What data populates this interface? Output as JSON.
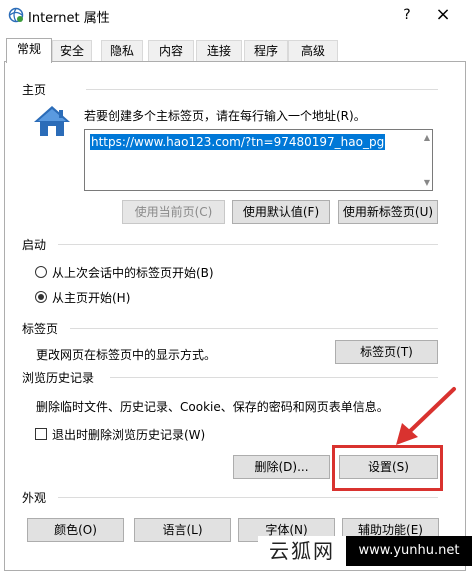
{
  "window": {
    "title": "Internet 属性",
    "help": "?",
    "close": "×"
  },
  "tabs": [
    "常规",
    "安全",
    "隐私",
    "内容",
    "连接",
    "程序",
    "高级"
  ],
  "home": {
    "group_label": "主页",
    "instruction": "若要创建多个主标签页，请在每行输入一个地址(R)。",
    "url": "https://www.hao123.com/?tn=97480197_hao_pg",
    "buttons": {
      "use_current": "使用当前页(C)",
      "use_default": "使用默认值(F)",
      "use_new_tab": "使用新标签页(U)"
    }
  },
  "startup": {
    "group_label": "启动",
    "option_last_session": "从上次会话中的标签页开始(B)",
    "option_home": "从主页开始(H)",
    "selected": "home"
  },
  "tab_section": {
    "group_label": "标签页",
    "description": "更改网页在标签页中的显示方式。",
    "button": "标签页(T)"
  },
  "history": {
    "group_label": "浏览历史记录",
    "description": "删除临时文件、历史记录、Cookie、保存的密码和网页表单信息。",
    "checkbox_label": "退出时删除浏览历史记录(W)",
    "checkbox_checked": false,
    "delete_button": "删除(D)...",
    "settings_button": "设置(S)"
  },
  "appearance": {
    "group_label": "外观",
    "buttons": [
      "颜色(O)",
      "语言(L)",
      "字体(N)",
      "辅助功能(E)"
    ]
  },
  "watermark": {
    "left": "云狐网",
    "right": "www.yunhu.net"
  },
  "colors": {
    "highlight": "#d9322f",
    "selection": "#0078d7",
    "icon_blue": "#2b6cb8"
  }
}
